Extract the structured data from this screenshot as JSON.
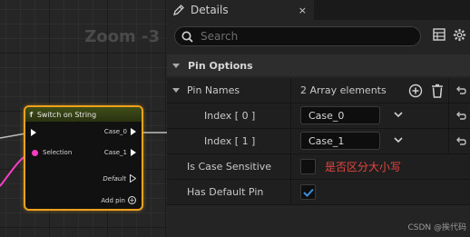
{
  "graph": {
    "zoom_label": "Zoom -3",
    "node": {
      "title": "Switch on String",
      "function_icon": "f",
      "pins": {
        "case_0": "Case_0",
        "case_1": "Case_1",
        "selection": "Selection",
        "default": "Default",
        "add_pin": "Add pin"
      }
    }
  },
  "details": {
    "tab_title": "Details",
    "tab_close": "×",
    "search_placeholder": "Search",
    "section_title": "Pin Options",
    "pin_names": {
      "label": "Pin Names",
      "value": "2 Array elements"
    },
    "items": [
      {
        "label": "Index [ 0 ]",
        "value": "Case_0"
      },
      {
        "label": "Index [ 1 ]",
        "value": "Case_1"
      }
    ],
    "is_case_sensitive": {
      "label": "Is Case Sensitive",
      "checked": false
    },
    "annotation": "是否区分大小写",
    "has_default_pin": {
      "label": "Has Default Pin",
      "checked": true
    }
  },
  "watermark": "CSDN @挨代码",
  "colors": {
    "node_border": "#f0a21d",
    "node_header": "#3f4e17",
    "string_pin": "#f33ec4",
    "annotation": "#e8443f",
    "checkbox_check": "#3a8fe0"
  }
}
